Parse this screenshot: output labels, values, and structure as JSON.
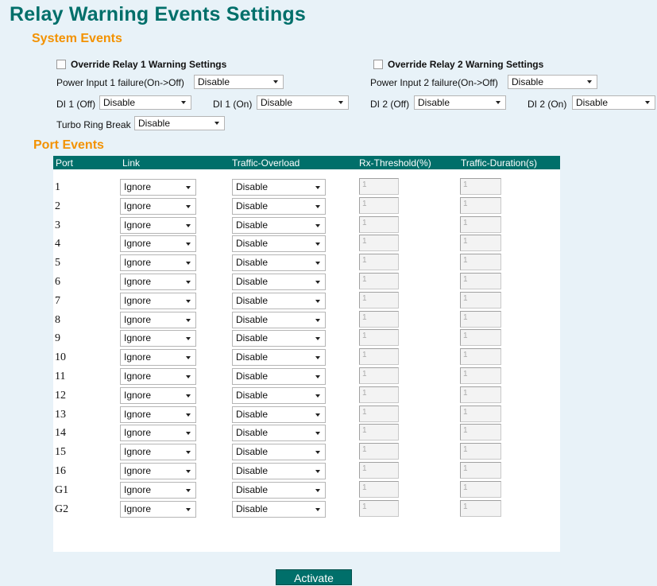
{
  "page": {
    "title": "Relay Warning Events Settings"
  },
  "system_events": {
    "title": "System Events",
    "override_relay1": {
      "label": "Override Relay 1 Warning Settings",
      "checked": false
    },
    "override_relay2": {
      "label": "Override Relay 2 Warning Settings",
      "checked": false
    },
    "power_input1": {
      "label": "Power Input 1 failure(On->Off)",
      "value": "Disable"
    },
    "power_input2": {
      "label": "Power Input 2 failure(On->Off)",
      "value": "Disable"
    },
    "di1_off": {
      "label": "DI 1 (Off)",
      "value": "Disable"
    },
    "di1_on": {
      "label": "DI 1 (On)",
      "value": "Disable"
    },
    "di2_off": {
      "label": "DI 2 (Off)",
      "value": "Disable"
    },
    "di2_on": {
      "label": "DI 2 (On)",
      "value": "Disable"
    },
    "turbo_ring_break": {
      "label": "Turbo Ring Break",
      "value": "Disable"
    }
  },
  "port_events": {
    "title": "Port Events",
    "columns": [
      "Port",
      "Link",
      "Traffic-Overload",
      "Rx-Threshold(%)",
      "Traffic-Duration(s)"
    ],
    "rows": [
      {
        "port": "1",
        "link": "Ignore",
        "traffic_overload": "Disable",
        "rx_threshold": "1",
        "traffic_duration": "1"
      },
      {
        "port": "2",
        "link": "Ignore",
        "traffic_overload": "Disable",
        "rx_threshold": "1",
        "traffic_duration": "1"
      },
      {
        "port": "3",
        "link": "Ignore",
        "traffic_overload": "Disable",
        "rx_threshold": "1",
        "traffic_duration": "1"
      },
      {
        "port": "4",
        "link": "Ignore",
        "traffic_overload": "Disable",
        "rx_threshold": "1",
        "traffic_duration": "1"
      },
      {
        "port": "5",
        "link": "Ignore",
        "traffic_overload": "Disable",
        "rx_threshold": "1",
        "traffic_duration": "1"
      },
      {
        "port": "6",
        "link": "Ignore",
        "traffic_overload": "Disable",
        "rx_threshold": "1",
        "traffic_duration": "1"
      },
      {
        "port": "7",
        "link": "Ignore",
        "traffic_overload": "Disable",
        "rx_threshold": "1",
        "traffic_duration": "1"
      },
      {
        "port": "8",
        "link": "Ignore",
        "traffic_overload": "Disable",
        "rx_threshold": "1",
        "traffic_duration": "1"
      },
      {
        "port": "9",
        "link": "Ignore",
        "traffic_overload": "Disable",
        "rx_threshold": "1",
        "traffic_duration": "1"
      },
      {
        "port": "10",
        "link": "Ignore",
        "traffic_overload": "Disable",
        "rx_threshold": "1",
        "traffic_duration": "1"
      },
      {
        "port": "11",
        "link": "Ignore",
        "traffic_overload": "Disable",
        "rx_threshold": "1",
        "traffic_duration": "1"
      },
      {
        "port": "12",
        "link": "Ignore",
        "traffic_overload": "Disable",
        "rx_threshold": "1",
        "traffic_duration": "1"
      },
      {
        "port": "13",
        "link": "Ignore",
        "traffic_overload": "Disable",
        "rx_threshold": "1",
        "traffic_duration": "1"
      },
      {
        "port": "14",
        "link": "Ignore",
        "traffic_overload": "Disable",
        "rx_threshold": "1",
        "traffic_duration": "1"
      },
      {
        "port": "15",
        "link": "Ignore",
        "traffic_overload": "Disable",
        "rx_threshold": "1",
        "traffic_duration": "1"
      },
      {
        "port": "16",
        "link": "Ignore",
        "traffic_overload": "Disable",
        "rx_threshold": "1",
        "traffic_duration": "1"
      },
      {
        "port": "G1",
        "link": "Ignore",
        "traffic_overload": "Disable",
        "rx_threshold": "1",
        "traffic_duration": "1"
      },
      {
        "port": "G2",
        "link": "Ignore",
        "traffic_overload": "Disable",
        "rx_threshold": "1",
        "traffic_duration": "1"
      }
    ]
  },
  "actions": {
    "activate_label": "Activate"
  },
  "colors": {
    "title": "#006f6a",
    "section": "#f39200",
    "header_bg": "#006f6a",
    "page_bg": "#e8f2f8"
  }
}
